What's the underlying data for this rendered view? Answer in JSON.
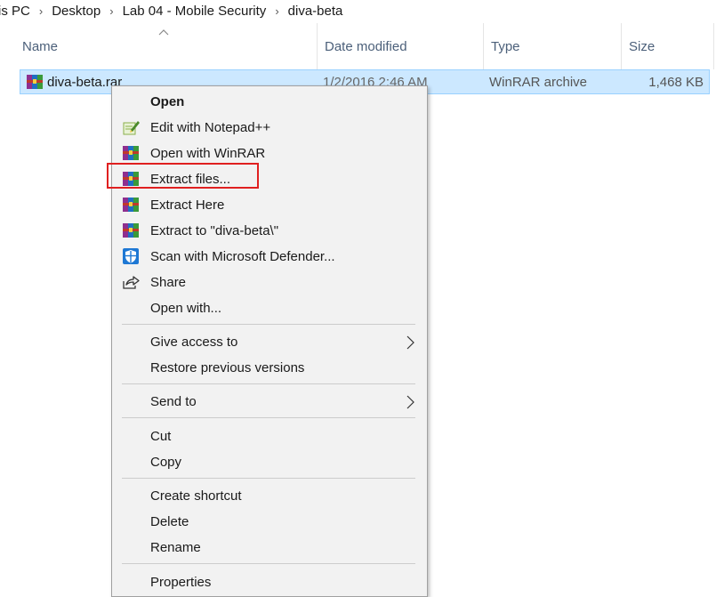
{
  "breadcrumb": {
    "items": [
      "is PC",
      "Desktop",
      "Lab 04 - Mobile Security",
      "diva-beta"
    ]
  },
  "columns": {
    "name": "Name",
    "date_modified": "Date modified",
    "type": "Type",
    "size": "Size",
    "sort_indicator": "chevron-up-icon"
  },
  "file": {
    "name": "diva-beta.rar",
    "date_modified": "1/2/2016 2:46 AM",
    "type": "WinRAR archive",
    "size": "1,468 KB",
    "icon": "winrar-icon",
    "selected": true
  },
  "context_menu": {
    "items": [
      {
        "label": "Open",
        "bold": true
      },
      {
        "label": "Edit with Notepad++",
        "icon": "notepadpp-icon"
      },
      {
        "label": "Open with WinRAR",
        "icon": "winrar-icon"
      },
      {
        "label": "Extract files...",
        "icon": "winrar-icon",
        "highlighted": true
      },
      {
        "label": "Extract Here",
        "icon": "winrar-icon"
      },
      {
        "label": "Extract to \"diva-beta\\\"",
        "icon": "winrar-icon"
      },
      {
        "label": "Scan with Microsoft Defender...",
        "icon": "defender-shield-icon"
      },
      {
        "label": "Share",
        "icon": "share-icon"
      },
      {
        "label": "Open with..."
      },
      {
        "label": "Give access to",
        "submenu": true
      },
      {
        "label": "Restore previous versions"
      },
      {
        "label": "Send to",
        "submenu": true
      },
      {
        "label": "Cut"
      },
      {
        "label": "Copy"
      },
      {
        "label": "Create shortcut"
      },
      {
        "label": "Delete"
      },
      {
        "label": "Rename"
      },
      {
        "label": "Properties"
      }
    ]
  },
  "colors": {
    "selection_bg": "#cce8ff",
    "selection_border": "#99d1ff",
    "menu_bg": "#f2f2f2",
    "highlight_red": "#e02020",
    "header_text": "#4c607a"
  }
}
